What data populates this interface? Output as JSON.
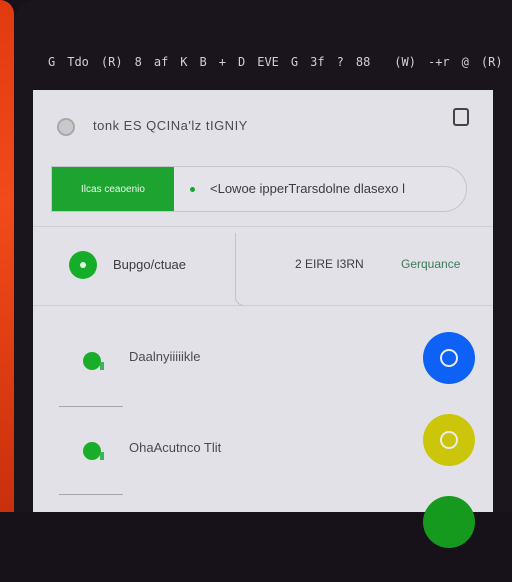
{
  "statusbar": {
    "left_items": [
      "G",
      "Tdo",
      "(R)",
      "8",
      "af",
      "K",
      "B",
      "+",
      "D",
      "EVE",
      "G",
      "3f",
      "?",
      "88"
    ],
    "right_items": [
      "(W)",
      "-+r",
      "@",
      "(R)"
    ]
  },
  "header": {
    "title": "tonk ES QCINa'lz tIGNIY",
    "logo_icon": "app-logo-icon",
    "copy_icon": "copy-icon"
  },
  "search": {
    "button_label": "Ilcas ceaoenio",
    "value": "<Lowoe ipperTrarsdolne dlasexo l"
  },
  "tabs": {
    "left_label": "Bupgo/ctuae",
    "middle_label": "2 EIRE I3RN",
    "right_label": "Gerquance"
  },
  "list": [
    {
      "label": "Daalnyiiiiikle",
      "action_color": "#0d61f5"
    },
    {
      "label": "OhaAcutnco Tlit",
      "action_color": "#cbc609"
    },
    {
      "label": "",
      "action_color": "#169a1e"
    }
  ],
  "colors": {
    "accent_green": "#1da32f",
    "bezel_orange": "#f24a1a"
  }
}
